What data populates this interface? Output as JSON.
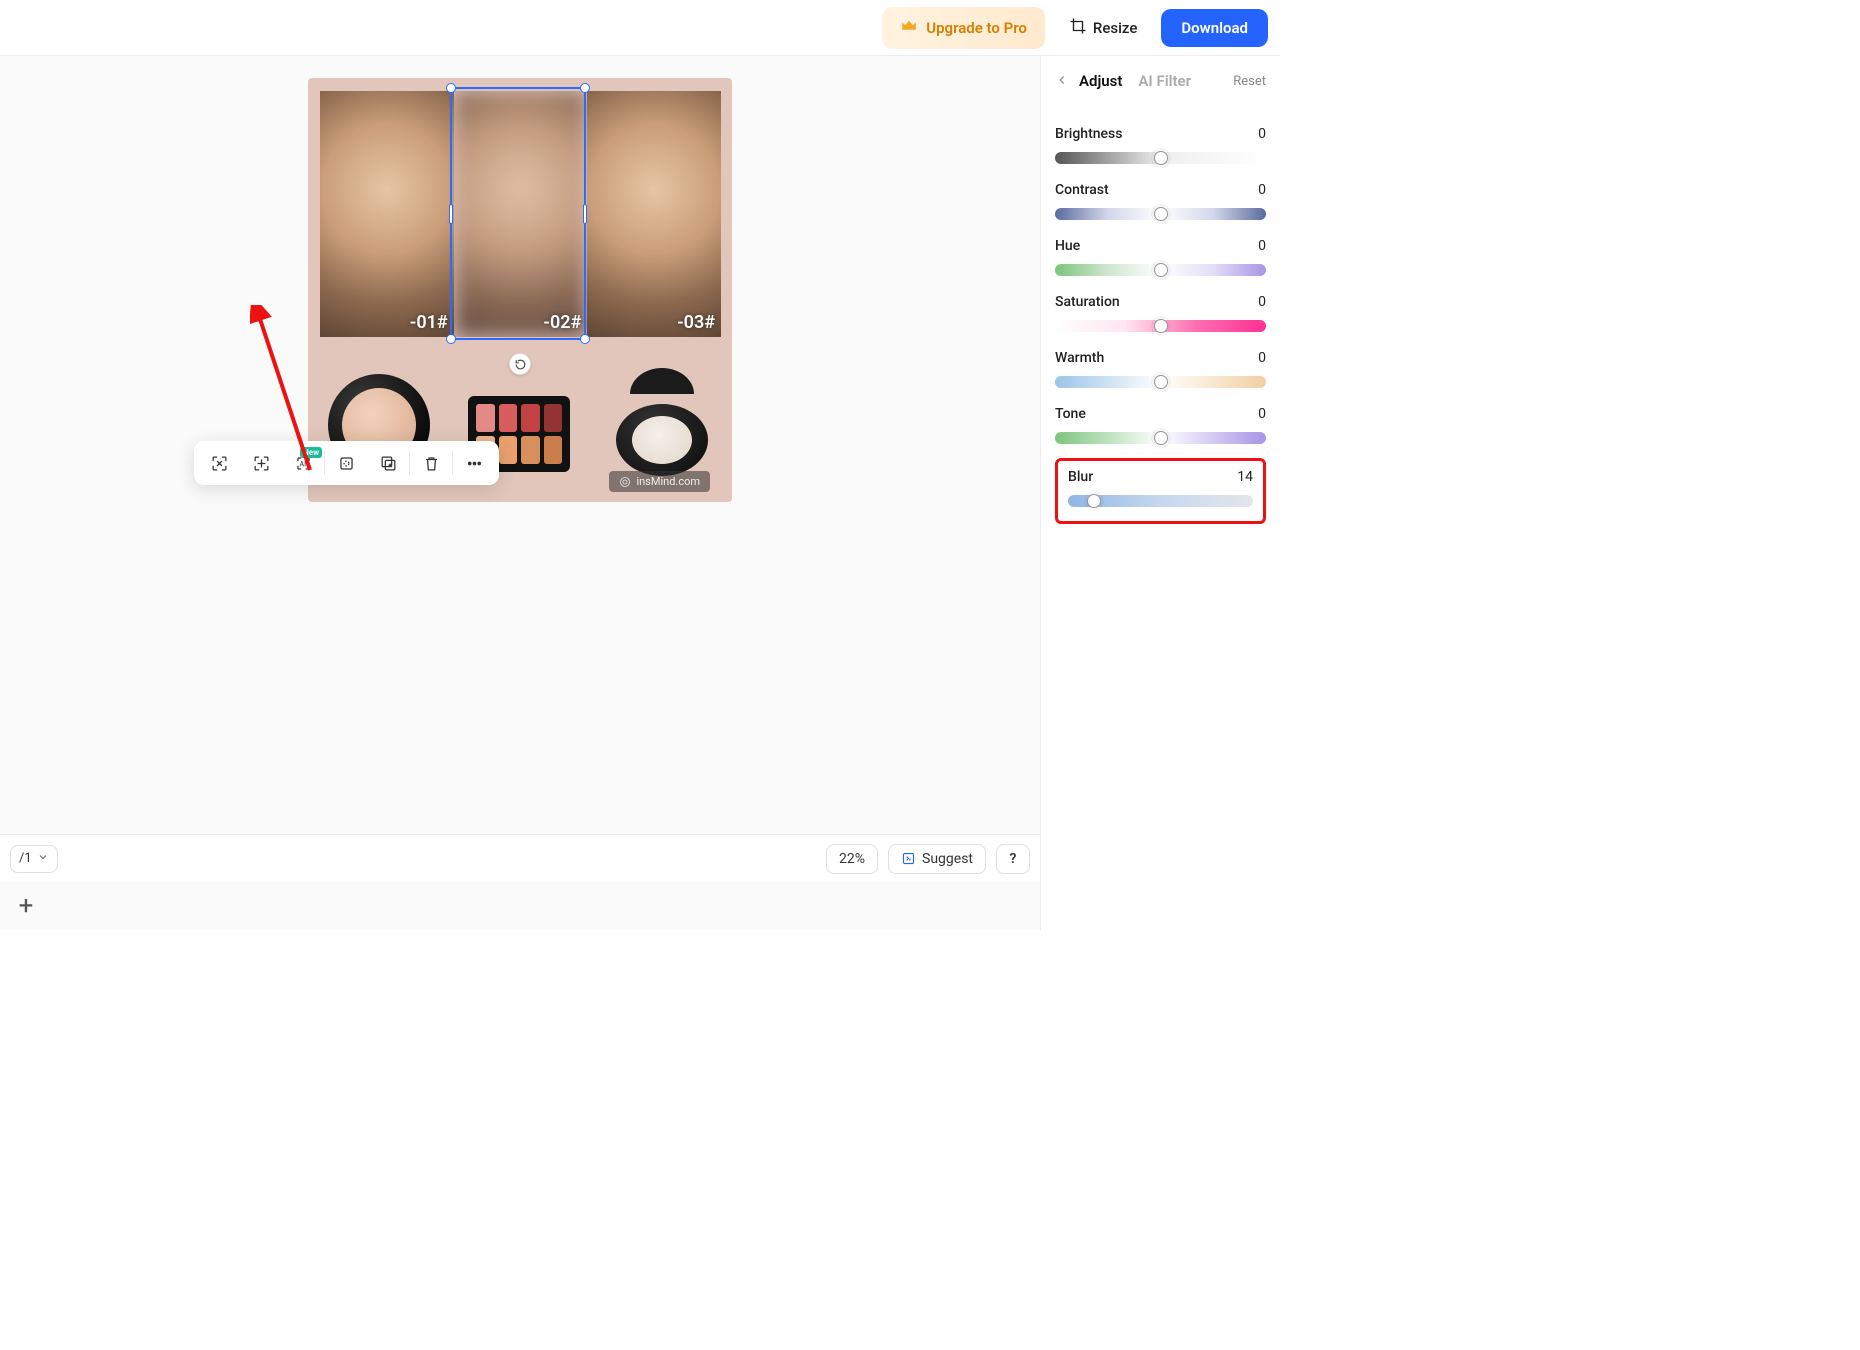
{
  "topbar": {
    "upgrade_label": "Upgrade to Pro",
    "resize_label": "Resize",
    "download_label": "Download"
  },
  "canvas": {
    "models": [
      {
        "label": "-01#"
      },
      {
        "label": "-02#"
      },
      {
        "label": "-03#"
      }
    ],
    "watermark_text": "insMind.com",
    "toolbar_new_badge": "New"
  },
  "util": {
    "page_label": "/1",
    "zoom_label": "22%",
    "suggest_label": "Suggest",
    "help_label": "?",
    "add_label": "+"
  },
  "sidebar": {
    "tab_adjust": "Adjust",
    "tab_ai_filter": "AI Filter",
    "reset_label": "Reset",
    "controls": [
      {
        "name": "Brightness",
        "value": "0",
        "cls": "brightness",
        "pos": 50
      },
      {
        "name": "Contrast",
        "value": "0",
        "cls": "contrast",
        "pos": 50
      },
      {
        "name": "Hue",
        "value": "0",
        "cls": "hue",
        "pos": 50
      },
      {
        "name": "Saturation",
        "value": "0",
        "cls": "saturation",
        "pos": 50
      },
      {
        "name": "Warmth",
        "value": "0",
        "cls": "warmth",
        "pos": 50
      },
      {
        "name": "Tone",
        "value": "0",
        "cls": "tone",
        "pos": 50
      }
    ],
    "blur": {
      "name": "Blur",
      "value": "14",
      "cls": "blur",
      "pos": 14
    }
  }
}
